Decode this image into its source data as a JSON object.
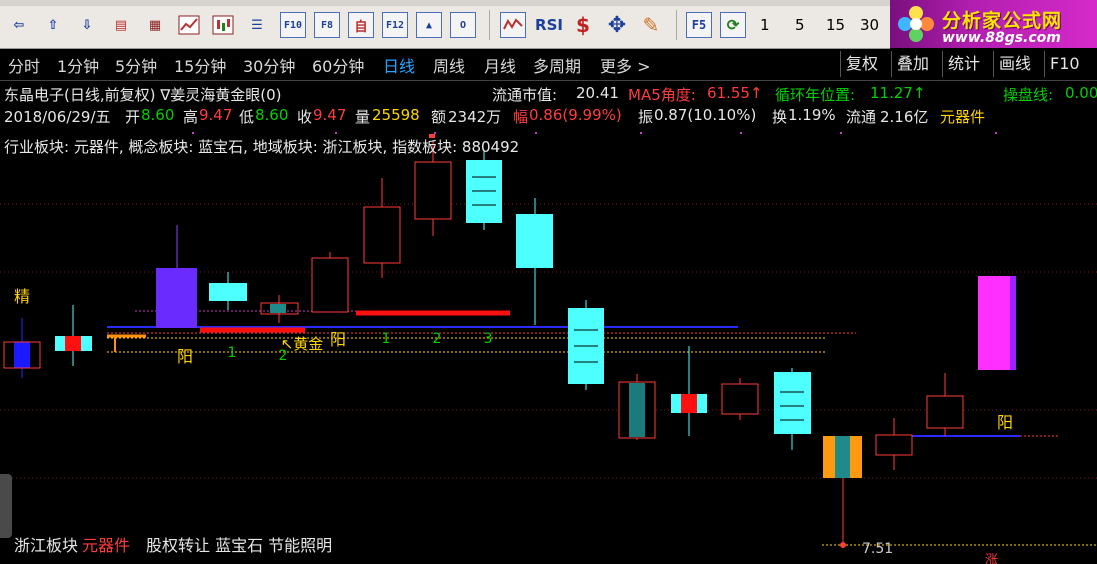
{
  "toolbar": {
    "buttons": [
      {
        "icon": "back-icon",
        "glyph": "⇦"
      },
      {
        "icon": "up-arrow-icon",
        "glyph": "⇧"
      },
      {
        "icon": "down-arrow-icon",
        "glyph": "⇩"
      },
      {
        "icon": "report-icon",
        "glyph": "▤"
      },
      {
        "icon": "grid-icon",
        "glyph": "▦"
      },
      {
        "icon": "line-chart-icon",
        "glyph": "📈"
      },
      {
        "icon": "candle-icon",
        "glyph": "▮"
      },
      {
        "icon": "list-icon",
        "glyph": "☰"
      }
    ],
    "key_buttons": [
      "F10",
      "F8",
      "自",
      "F12",
      "▲",
      "O"
    ],
    "rsi_label": "RSI",
    "dollar_glyph": "$",
    "cross_glyph": "✥",
    "pencil_glyph": "✎",
    "f5_label": "F5",
    "refresh_glyph": "⟳",
    "periods_quick": [
      "1",
      "5",
      "15",
      "30"
    ]
  },
  "brand": {
    "name": "分析家公式网",
    "url": "www.88gs.com"
  },
  "period_bar": {
    "items": [
      "分时",
      "1分钟",
      "5分钟",
      "15分钟",
      "30分钟",
      "60分钟",
      "日线",
      "周线",
      "月线",
      "多周期",
      "更多 >"
    ],
    "active": "日线",
    "right_items": [
      "复权",
      "叠加",
      "统计",
      "画线",
      "F10"
    ]
  },
  "info_line_1": {
    "title": "东晶电子(日线,前复权) ∇姜灵海黄金眼(0)",
    "float_mv_label": "流通市值:",
    "float_mv_value": "20.41",
    "ma5_label": "MA5角度:",
    "ma5_value": "61.55↑",
    "cycle_label": "循环年位置:",
    "cycle_value": "11.27↑",
    "operate_label": "操盘线:",
    "operate_value": "0.00"
  },
  "info_line_2": {
    "date": "2018/06/29/五",
    "open_label": "开",
    "open": "8.60",
    "high_label": "高",
    "high": "9.47",
    "low_label": "低",
    "low": "8.60",
    "close_label": "收",
    "close": "9.47",
    "volume_label": "量",
    "volume": "25598",
    "amount_label": "额",
    "amount": "2342万",
    "range_label": "幅",
    "range": "0.86(9.99%)",
    "amp_label": "振",
    "amp": "0.87(10.10%)",
    "turnover_label": "换",
    "turnover": "1.19%",
    "float_label": "流通",
    "float": "2.16亿",
    "sector": "元器件"
  },
  "info_line_3": "行业板块: 元器件, 概念板块: 蓝宝石, 地域板块: 浙江板块, 指数板块: 880492",
  "chart_labels": {
    "jing": "精",
    "yang": "阳",
    "n1": "1",
    "n2": "2",
    "n3": "3",
    "huangjin": "↖黄金",
    "price_low": "7.51",
    "zhang": "涨"
  },
  "bottom": {
    "region": "浙江板块",
    "industry": "元器件",
    "concepts": "股权转让 蓝宝石 节能照明"
  },
  "colors": {
    "up": "#ff3c3c",
    "down_fill": "#4dffff",
    "gold": "#ffd400",
    "green_text": "#00d000",
    "magenta": "#ff40ff",
    "blue_line": "#2a2aff"
  }
}
